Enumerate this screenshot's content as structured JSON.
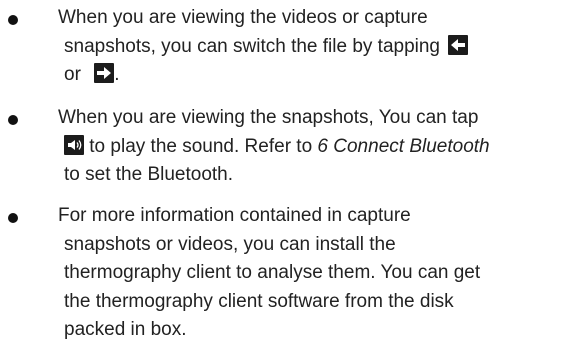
{
  "bullets": [
    {
      "line1": "When you are viewing the videos or capture",
      "line2": "snapshots, you can switch the file by tapping",
      "line3_pre": "or",
      "line3_post": ".",
      "icons": [
        "arrow-left-icon",
        "arrow-right-icon"
      ]
    },
    {
      "line1": "When you are viewing the snapshots, You can tap",
      "line2_post": " to play the sound. Refer to ",
      "line2_ref": "6 Connect Bluetooth",
      "line3": "to set the Bluetooth.",
      "icons": [
        "speaker-icon"
      ]
    },
    {
      "line1": "For more information contained in capture",
      "line2": "snapshots or videos, you can install the",
      "line3": "thermography client to analyse them. You can get",
      "line4": "the thermography client software from the disk",
      "line5": "packed in box."
    }
  ]
}
